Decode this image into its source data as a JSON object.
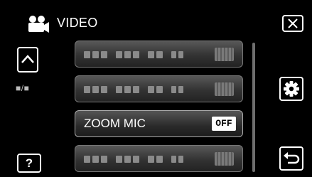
{
  "header": {
    "title": "VIDEO",
    "mode_icon": "video-camera-icon"
  },
  "buttons": {
    "close": "close-icon",
    "scroll_up": "chevron-up-icon",
    "mode_toggle": "■/■",
    "help": "?",
    "settings": "gear-icon",
    "back": "return-icon"
  },
  "menu": {
    "items": [
      {
        "label": "",
        "value": ""
      },
      {
        "label": "",
        "value": ""
      },
      {
        "label": "ZOOM MIC",
        "value": "OFF"
      },
      {
        "label": "",
        "value": ""
      }
    ]
  },
  "colors": {
    "background": "#000000",
    "foreground": "#ffffff",
    "button_gradient_top": "#585858"
  }
}
